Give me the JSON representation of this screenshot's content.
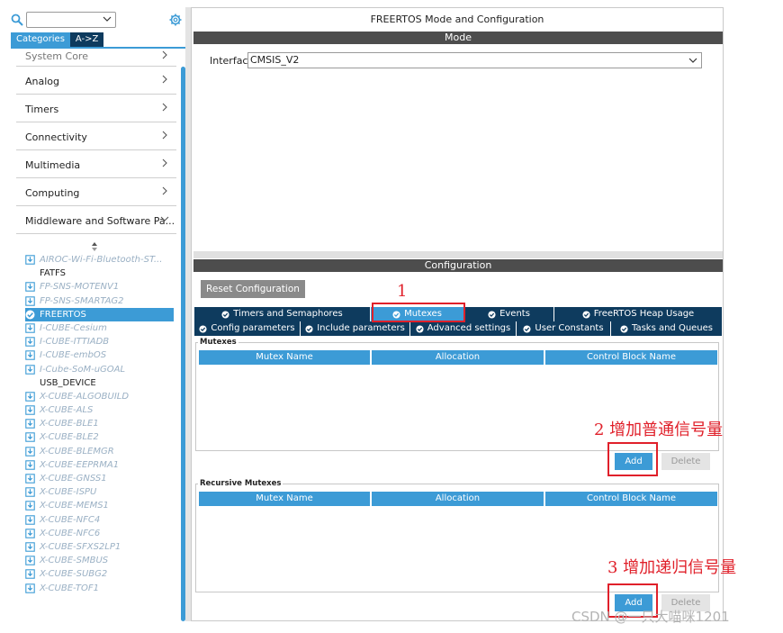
{
  "sidebar": {
    "tabs": [
      "Categories",
      "A->Z"
    ],
    "categories": [
      "System Core",
      "Analog",
      "Timers",
      "Connectivity",
      "Multimedia",
      "Computing",
      "Middleware and Software Pa..."
    ],
    "middleware": [
      "AIROC-Wi-Fi-Bluetooth-ST...",
      "FATFS",
      "FP-SNS-MOTENV1",
      "FP-SNS-SMARTAG2",
      "FREERTOS",
      "I-CUBE-Cesium",
      "I-CUBE-ITTIADB",
      "I-CUBE-embOS",
      "I-Cube-SoM-uGOAL",
      "USB_DEVICE",
      "X-CUBE-ALGOBUILD",
      "X-CUBE-ALS",
      "X-CUBE-BLE1",
      "X-CUBE-BLE2",
      "X-CUBE-BLEMGR",
      "X-CUBE-EEPRMA1",
      "X-CUBE-GNSS1",
      "X-CUBE-ISPU",
      "X-CUBE-MEMS1",
      "X-CUBE-NFC4",
      "X-CUBE-NFC6",
      "X-CUBE-SFXS2LP1",
      "X-CUBE-SMBUS",
      "X-CUBE-SUBG2",
      "X-CUBE-TOF1"
    ],
    "selected": "FREERTOS"
  },
  "main": {
    "title": "FREERTOS Mode and Configuration",
    "mode_header": "Mode",
    "interface_label": "Interface",
    "interface_value": "CMSIS_V2",
    "config_header": "Configuration",
    "reset_label": "Reset Configuration",
    "tabs_row1": [
      "Timers and Semaphores",
      "Mutexes",
      "Events",
      "FreeRTOS Heap Usage"
    ],
    "tabs_row2": [
      "Config parameters",
      "Include parameters",
      "Advanced settings",
      "User Constants",
      "Tasks and Queues"
    ],
    "active_tab": "Mutexes",
    "mutexes": {
      "title": "Mutexes",
      "columns": [
        "Mutex Name",
        "Allocation",
        "Control Block Name"
      ],
      "add_label": "Add",
      "delete_label": "Delete"
    },
    "recursive": {
      "title": "Recursive Mutexes",
      "columns": [
        "Mutex Name",
        "Allocation",
        "Control Block Name"
      ],
      "add_label": "Add",
      "delete_label": "Delete"
    }
  },
  "annotations": {
    "a1": "1",
    "a2": "2 增加普通信号量",
    "a3": "3 增加递归信号量",
    "color": "#e0202a"
  },
  "watermark": "CSDN @一只大喵咪1201",
  "colors": {
    "accent": "#3c9bd6",
    "dark_tab": "#0e3b5e",
    "header_bar": "#4d4d4d"
  }
}
